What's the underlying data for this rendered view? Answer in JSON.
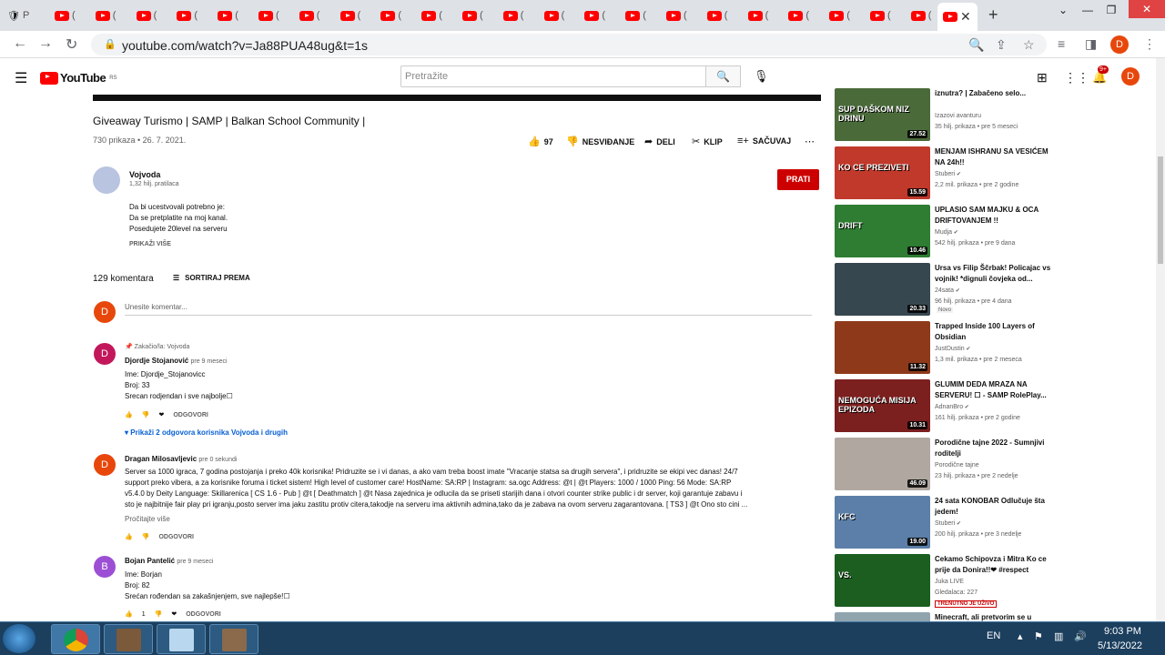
{
  "browser": {
    "tab_title": "P",
    "tab_q": "(",
    "url": "youtube.com/watch?v=Ja88PUA48ug&t=1s",
    "profile_initial": "D"
  },
  "yt": {
    "logo_text": "YouTube",
    "region": "RS",
    "search_placeholder": "Pretražite",
    "notif_count": "9+",
    "profile_initial": "D"
  },
  "video": {
    "title": "Giveaway Turismo | SAMP | Balkan School Community |",
    "meta": "730 prikaza • 26. 7. 2021.",
    "likes": "97",
    "dislike": "NESVIĐANJE",
    "share": "DELI",
    "clip": "KLIP",
    "save": "SAČUVAJ"
  },
  "channel": {
    "name": "Vojvoda",
    "subs": "1,32 hilj. pratilaca",
    "subscribe": "PRATI",
    "desc": [
      "Da bi ucestvovali potrebno je:",
      "Da se pretplatite na moj kanal.",
      "Posedujete 20level na serveru"
    ],
    "show_more": "PRIKAŽI VIŠE"
  },
  "comments": {
    "count": "129 komentara",
    "sort": "SORTIRAJ PREMA",
    "add_placeholder": "Unesite komentar...",
    "user_initial": "D",
    "reply_label": "ODGOVORI",
    "items": [
      {
        "initial": "D",
        "color": "#c2185b",
        "pinned": "Zakačio/la: Vojvoda",
        "author": "Djordje Stojanović",
        "time": "pre 9 meseci",
        "lines": [
          "Ime: Djordje_Stojanovicc",
          "Broj: 33",
          "Srecan rodjendan i sve najbolje☐"
        ],
        "likes": ""
      },
      {
        "initial": "D",
        "color": "#e8470c",
        "author": "Dragan Milosavljevic",
        "time": "pre 0 sekundi",
        "lines": [
          "Server sa 1000 igraca, 7 godina postojanja i preko 40k korisnika! Pridruzite se i vi danas, a ako vam treba boost imate \"Vracanje statsa sa drugih servera\", i pridruzite se ekipi vec danas! 24/7",
          "support preko vibera, a za korisnike foruma i ticket sistem! High level of customer care! HostName: SA:RP | Instagram: sa.ogc Address: @t | @t Players: 1000 / 1000 Ping: 56 Mode: SA:RP",
          "v5.4.0 by Deity Language: Skillarenica [ CS 1.6 - Pub ] @t [ Deathmatch ] @t Nasa zajednica je odlucila da se priseti starijih dana i otvori counter strike public i dr server, koji garantuje zabavu i",
          "sto je najbitnije fair play pri igranju,posto server ima jaku zastitu protiv citera,takodje na serveru ima aktivnih admina,tako da je zabava na ovom serveru zagarantovana. [ TS3 ] @t Ono sto cini ..."
        ],
        "likes": ""
      },
      {
        "initial": "B",
        "color": "#9c4fd4",
        "author": "Bojan Pantelić",
        "time": "pre 9 meseci",
        "lines": [
          "Ime: Borjan",
          "Broj: 82",
          "Srećan rođendan sa zakašnjenjem, sve najlepše!☐"
        ],
        "likes": "1"
      }
    ],
    "replies_link": "Prikaži 2 odgovora korisnika Vojvoda i drugih",
    "read_more": "Pročitajte više"
  },
  "suggestions": [
    {
      "title": "iznutra? | Zabačeno selo...",
      "channel": "Izazovi avanturu",
      "views": "35 hilj. prikaza • pre 5 meseci",
      "duration": "27.52",
      "overlay": "SUP DAŠKOM NIZ DRINU",
      "bg": "#4a6a3a",
      "verified": false,
      "live": false,
      "novo": false
    },
    {
      "title": "MENJAM ISHRANU SA VESIĆEM NA 24h!!",
      "channel": "Stuberi",
      "views": "2,2 mil. prikaza • pre 2 godine",
      "duration": "15.59",
      "overlay": "KO CE PREZIVETI",
      "bg": "#c0392b",
      "verified": true,
      "live": false,
      "novo": false
    },
    {
      "title": "UPLASIO SAM MAJKU & OCA DRIFTOVANJEM !!",
      "channel": "Mudja",
      "views": "542 hilj. prikaza • pre 9 dana",
      "duration": "10.46",
      "overlay": "DRIFT",
      "bg": "#2e7d32",
      "verified": true,
      "live": false,
      "novo": false
    },
    {
      "title": "Ursa vs Filip Ščrbak! Policajac vs vojnik! *dignuli čovjeka od...",
      "channel": "24sata",
      "views": "96 hilj. prikaza • pre 4 dana",
      "duration": "20.33",
      "overlay": "",
      "bg": "#37474f",
      "verified": true,
      "live": false,
      "novo": true,
      "novo_text": "Novo"
    },
    {
      "title": "Trapped Inside 100 Layers of Obsidian",
      "channel": "JustDustin",
      "views": "1,3 mil. prikaza • pre 2 meseca",
      "duration": "11.32",
      "overlay": "",
      "bg": "#8e3a1a",
      "verified": true,
      "live": false,
      "novo": false
    },
    {
      "title": "GLUMIM DEDA MRAZA NA SERVERU! ☐ - SAMP RolePlay...",
      "channel": "AdnanBro",
      "views": "161 hilj. prikaza • pre 2 godine",
      "duration": "10.31",
      "overlay": "NEMOGUĆA MISIJA EPIZODA",
      "bg": "#7b1f1f",
      "verified": true,
      "live": false,
      "novo": false
    },
    {
      "title": "Porodične tajne 2022 - Sumnjivi roditelji",
      "channel": "Porodične tajne",
      "views": "23 hilj. prikaza • pre 2 nedelje",
      "duration": "46.09",
      "overlay": "",
      "bg": "#b0a8a0",
      "verified": false,
      "live": false,
      "novo": false
    },
    {
      "title": "24 sata KONOBAR Odlučuje šta jedem!",
      "channel": "Stuberi",
      "views": "200 hilj. prikaza • pre 3 nedelje",
      "duration": "19.00",
      "overlay": "KFC",
      "bg": "#5b7fa8",
      "verified": true,
      "live": false,
      "novo": false
    },
    {
      "title": "Cekamo Schipovza i Mitra Ko ce prije da Donira!!❤ #respect",
      "channel": "Juka LIVE",
      "views": "Gledalaca: 227",
      "duration": "",
      "overlay": "VS.",
      "bg": "#1b5e20",
      "verified": false,
      "live": true,
      "live_text": "TRENUTNO JE UŽIVO",
      "novo": false
    },
    {
      "title": "Minecraft, ali pretvorim se u",
      "channel": "",
      "views": "",
      "duration": "",
      "overlay": "",
      "bg": "#90a4ae",
      "verified": false,
      "live": false,
      "novo": false
    }
  ],
  "taskbar": {
    "lang": "EN",
    "time": "9:03 PM",
    "date": "5/13/2022"
  }
}
